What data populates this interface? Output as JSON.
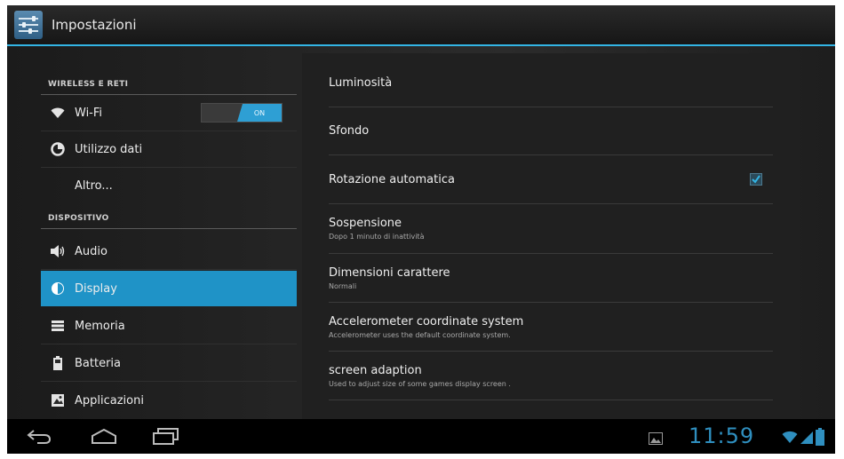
{
  "action_bar": {
    "title": "Impostazioni",
    "icon": "settings-sliders-icon"
  },
  "left_panel": {
    "sections": [
      {
        "header": "WIRELESS E RETI",
        "items": [
          {
            "label": "Wi-Fi",
            "icon": "wifi-icon",
            "toggle": "ON"
          },
          {
            "label": "Utilizzo dati",
            "icon": "data-usage-icon"
          },
          {
            "label": "Altro...",
            "icon": ""
          }
        ]
      },
      {
        "header": "DISPOSITIVO",
        "items": [
          {
            "label": "Audio",
            "icon": "speaker-icon"
          },
          {
            "label": "Display",
            "icon": "display-brightness-icon",
            "selected": true
          },
          {
            "label": "Memoria",
            "icon": "storage-icon"
          },
          {
            "label": "Batteria",
            "icon": "battery-icon"
          },
          {
            "label": "Applicazioni",
            "icon": "apps-icon"
          }
        ]
      }
    ]
  },
  "right_panel": {
    "items": [
      {
        "title": "Luminosità"
      },
      {
        "title": "Sfondo"
      },
      {
        "title": "Rotazione automatica",
        "checked": true
      },
      {
        "title": "Sospensione",
        "summary": "Dopo 1 minuto di inattività"
      },
      {
        "title": "Dimensioni carattere",
        "summary": "Normali"
      },
      {
        "title": "Accelerometer coordinate system",
        "summary": "Accelerometer uses the default coordinate system."
      },
      {
        "title": "screen adaption",
        "summary": "Used to adjust size of some games display screen ."
      }
    ]
  },
  "status_bar": {
    "time": "11:59",
    "icons": [
      "notification-image-icon",
      "wifi-signal-icon",
      "cell-signal-icon",
      "battery-icon"
    ]
  },
  "nav_bar": {
    "buttons": [
      "back-button",
      "home-button",
      "recent-apps-button"
    ]
  },
  "colors": {
    "accent": "#33b5e5",
    "selected": "#1f93c7",
    "background": "#101010"
  }
}
